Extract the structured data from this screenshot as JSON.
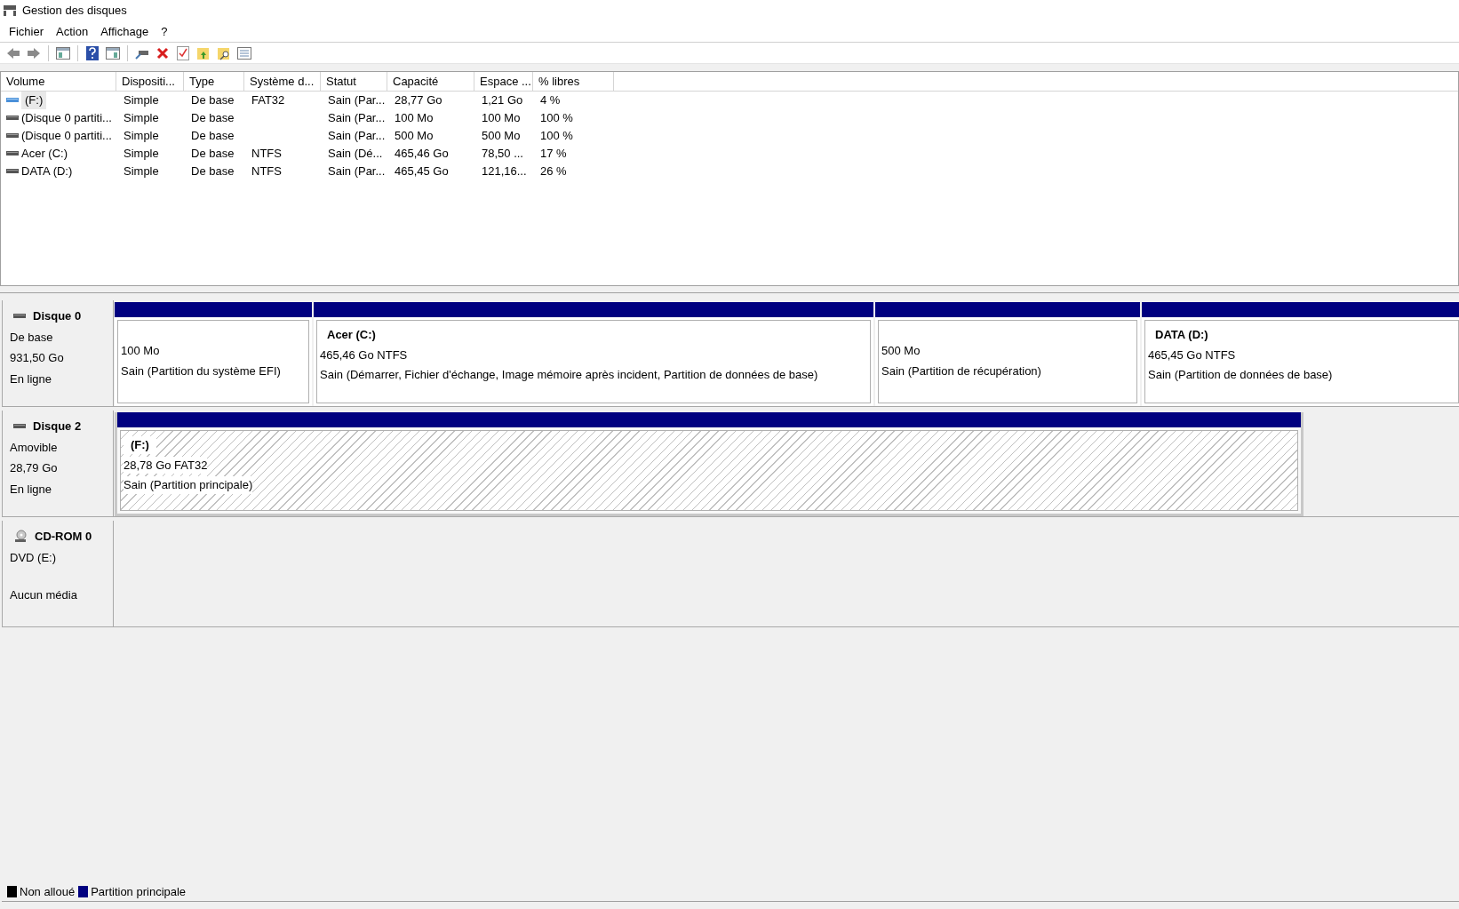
{
  "window": {
    "title": "Gestion des disques"
  },
  "menu": [
    "Fichier",
    "Action",
    "Affichage",
    "?"
  ],
  "table": {
    "columns": [
      "Volume",
      "Dispositi...",
      "Type",
      "Système d...",
      "Statut",
      "Capacité",
      "Espace ...",
      "% libres"
    ],
    "rows": [
      {
        "kind": "removable",
        "selected": true,
        "cells": [
          "(F:)",
          "Simple",
          "De base",
          "FAT32",
          "Sain (Par...",
          "28,77 Go",
          "1,21 Go",
          "4 %"
        ]
      },
      {
        "kind": "disk",
        "selected": false,
        "cells": [
          "(Disque 0 partiti...",
          "Simple",
          "De base",
          "",
          "Sain (Par...",
          "100 Mo",
          "100 Mo",
          "100 %"
        ]
      },
      {
        "kind": "disk",
        "selected": false,
        "cells": [
          "(Disque 0 partiti...",
          "Simple",
          "De base",
          "",
          "Sain (Par...",
          "500 Mo",
          "500 Mo",
          "100 %"
        ]
      },
      {
        "kind": "disk",
        "selected": false,
        "cells": [
          "Acer (C:)",
          "Simple",
          "De base",
          "NTFS",
          "Sain (Dé...",
          "465,46 Go",
          "78,50 ...",
          "17 %"
        ]
      },
      {
        "kind": "disk",
        "selected": false,
        "cells": [
          "DATA (D:)",
          "Simple",
          "De base",
          "NTFS",
          "Sain (Par...",
          "465,45 Go",
          "121,16...",
          "26 %"
        ]
      }
    ]
  },
  "disks": [
    {
      "kind": "disk",
      "name": "Disque 0",
      "lines": [
        "De base",
        "931,50 Go",
        "En ligne"
      ],
      "partitions": [
        {
          "lines": [
            "100 Mo",
            "Sain (Partition du système EFI)"
          ],
          "selected": false
        },
        {
          "title": "Acer  (C:)",
          "lines": [
            "465,46 Go NTFS",
            "Sain (Démarrer, Fichier d'échange, Image mémoire après incident, Partition de données de base)"
          ],
          "selected": false
        },
        {
          "lines": [
            "500 Mo",
            "Sain (Partition de récupération)"
          ],
          "selected": false
        },
        {
          "title": "DATA  (D:)",
          "lines": [
            "465,45 Go NTFS",
            "Sain (Partition de données de base)"
          ],
          "selected": false
        }
      ]
    },
    {
      "kind": "disk",
      "name": "Disque 2",
      "lines": [
        "Amovible",
        "28,79 Go",
        "En ligne"
      ],
      "partitions": [
        {
          "title": "(F:)",
          "lines": [
            "28,78 Go FAT32",
            "Sain (Partition principale)"
          ],
          "selected": true
        }
      ]
    },
    {
      "kind": "cdrom",
      "name": "CD-ROM 0",
      "lines": [
        "DVD (E:)",
        "Aucun média"
      ]
    }
  ],
  "legend": [
    {
      "label": "Non alloué",
      "color": "#000000"
    },
    {
      "label": "Partition principale",
      "color": "#000080"
    }
  ]
}
